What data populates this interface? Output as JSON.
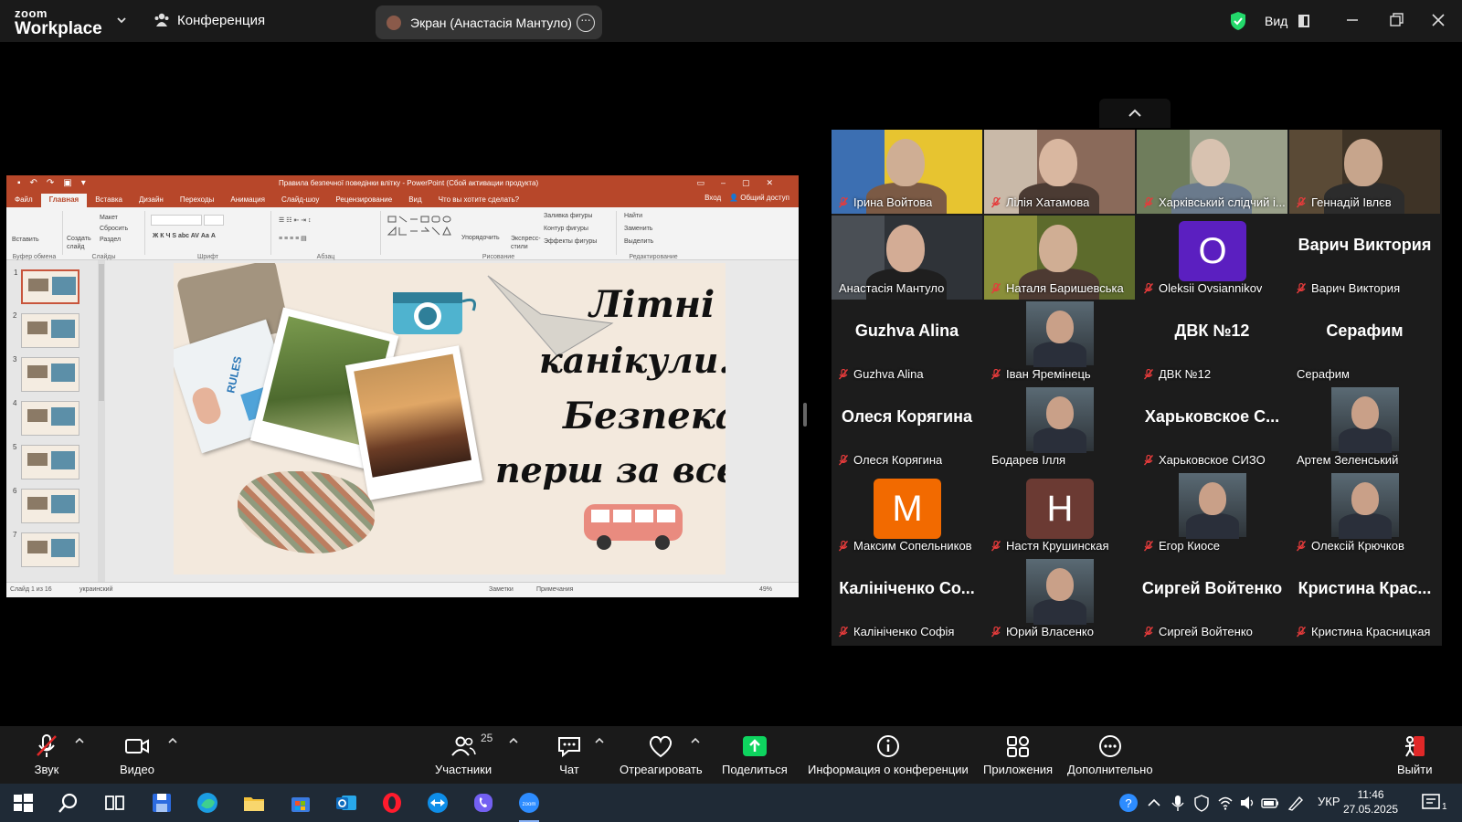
{
  "app": {
    "brand_line1": "zoom",
    "brand_line2": "Workplace",
    "meeting_label": "Конференция",
    "screen_share_label": "Экран (Анастасія Мантуло)",
    "view_label": "Вид"
  },
  "ppt": {
    "window_title": "Правила безпечної поведінки влітку - PowerPoint (Сбой активации продукта)",
    "tabs": [
      "Файл",
      "Главная",
      "Вставка",
      "Дизайн",
      "Переходы",
      "Анимация",
      "Слайд-шоу",
      "Рецензирование",
      "Вид",
      "Что вы хотите сделать?"
    ],
    "active_tab": "Главная",
    "signin": "Вход",
    "share": "Общий доступ",
    "ribbon": {
      "paste": "Вставить",
      "clipboard": "Буфер обмена",
      "new_slide": "Создать слайд",
      "layout": "Макет",
      "reset": "Сбросить",
      "section": "Раздел",
      "slides": "Слайды",
      "font": "Шрифт",
      "paragraph": "Абзац",
      "arrange": "Упорядочить",
      "quick_styles": "Экспресс-стили",
      "shape_fill": "Заливка фигуры",
      "shape_outline": "Контур фигуры",
      "shape_effects": "Эффекты фигуры",
      "drawing": "Рисование",
      "find": "Найти",
      "replace": "Заменить",
      "select": "Выделить",
      "editing": "Редактирование"
    },
    "slide_numbers": [
      "1",
      "2",
      "3",
      "4",
      "5",
      "6",
      "7"
    ],
    "slide_text": {
      "line1": "Літні",
      "line2": "канікули.",
      "line3": "Безпека",
      "line4": "перш за все!",
      "puzzle": "RULES"
    },
    "status": {
      "slide_count": "Слайд 1 из 16",
      "language": "украинский",
      "notes": "Заметки",
      "comments": "Примечания",
      "zoom": "49%"
    }
  },
  "participants": [
    {
      "name": "Ірина Войтова",
      "type": "video"
    },
    {
      "name": "Лілія Хатамова",
      "type": "video"
    },
    {
      "name": "Харківський слідчий і...",
      "type": "video"
    },
    {
      "name": "Геннадій Івлєв",
      "type": "video"
    },
    {
      "name": "Анастасія Мантуло",
      "type": "video",
      "active": true
    },
    {
      "name": "Наталя Баришевська",
      "type": "video"
    },
    {
      "name": "Oleksii Ovsiannikov",
      "type": "letter",
      "letter": "O",
      "color": "#5b1fc0"
    },
    {
      "name": "Варич Виктория",
      "type": "text",
      "display": "Варич Виктория"
    },
    {
      "name": "Guzhva Alina",
      "type": "text",
      "display": "Guzhva Alina"
    },
    {
      "name": "Іван Яремінець",
      "type": "photo"
    },
    {
      "name": "ДВК №12",
      "type": "text",
      "display": "ДВК №12"
    },
    {
      "name": "Серафим",
      "type": "text",
      "display": "Серафим"
    },
    {
      "name": "Олеся Корягина",
      "type": "text",
      "display": "Олеся Корягина"
    },
    {
      "name": "Бодарев Ілля",
      "type": "photo"
    },
    {
      "name": "Харьковское СИЗО",
      "type": "text",
      "display": "Харьковское С..."
    },
    {
      "name": "Артем Зеленський",
      "type": "photo"
    },
    {
      "name": "Максим Сопельников",
      "type": "letter",
      "letter": "M",
      "color": "#f26a00"
    },
    {
      "name": "Настя Крушинская",
      "type": "letter",
      "letter": "H",
      "color": "#6b3a33"
    },
    {
      "name": "Егор Киосе",
      "type": "photo"
    },
    {
      "name": "Олексій Крючков",
      "type": "photo"
    },
    {
      "name": "Калініченко Софія",
      "type": "text",
      "display": "Калініченко Со..."
    },
    {
      "name": "Юрий Власенко",
      "type": "photo"
    },
    {
      "name": "Сиргей Войтенко",
      "type": "text",
      "display": "Сиргей Войтенко"
    },
    {
      "name": "Кристина Красницкая",
      "type": "text",
      "display": "Кристина Крас..."
    }
  ],
  "toolbar": {
    "audio": "Звук",
    "video": "Видео",
    "participants": "Участники",
    "participants_count": "25",
    "chat": "Чат",
    "react": "Отреагировать",
    "share": "Поделиться",
    "info": "Информация о конференции",
    "apps": "Приложения",
    "more": "Дополнительно",
    "leave": "Выйти"
  },
  "taskbar": {
    "language": "УКР",
    "time": "11:46",
    "date": "27.05.2025",
    "notifications": "1"
  },
  "colors": {
    "accent_green": "#23d96b",
    "share_green": "#0ed45f",
    "ppt_red": "#b7472a"
  }
}
